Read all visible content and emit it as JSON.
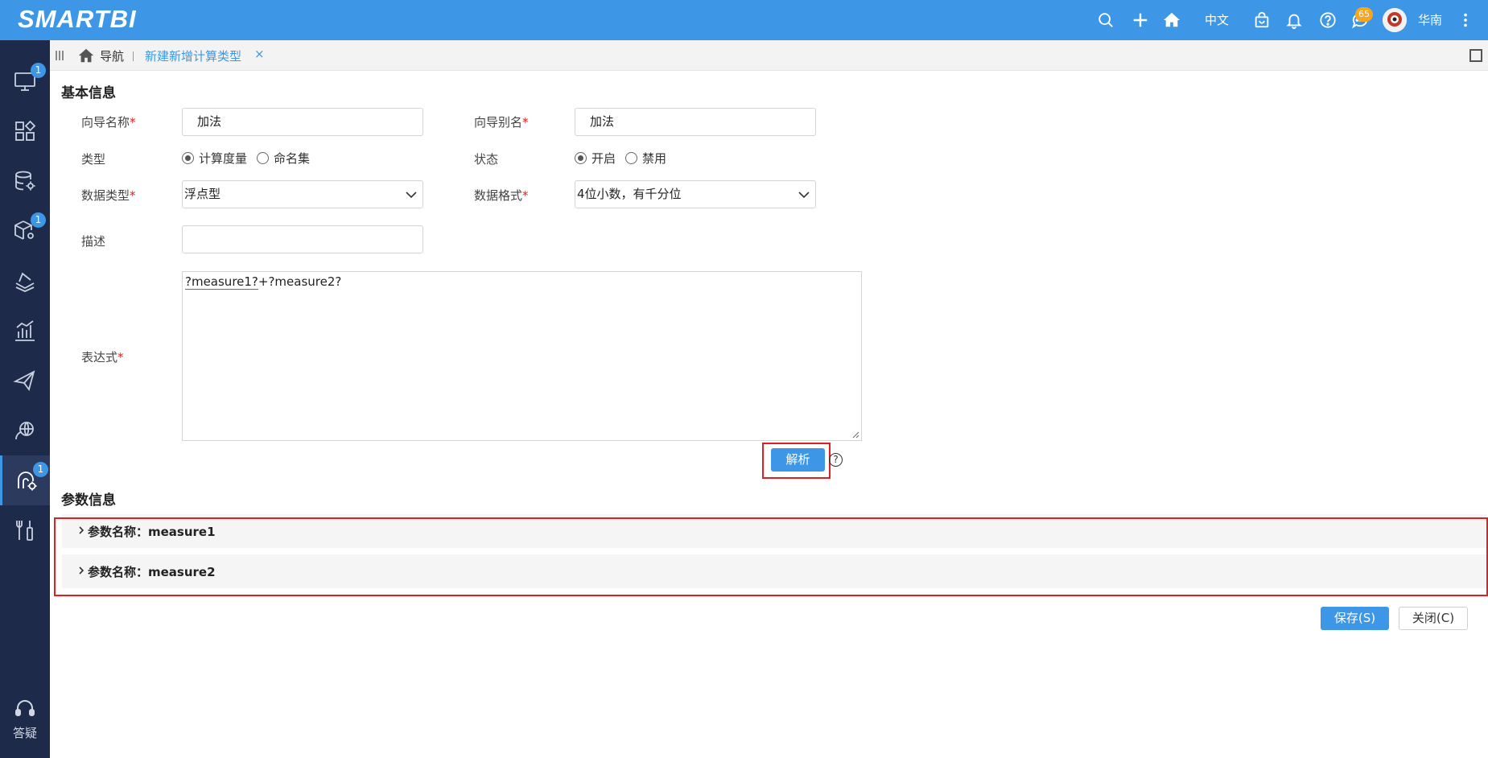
{
  "topbar": {
    "brand": "SMARTBI",
    "language": "中文",
    "messages_badge": "65",
    "user_name": "华南"
  },
  "sidebar": {
    "items": [
      {
        "icon": "monitor-icon",
        "badge": "1"
      },
      {
        "icon": "widgets-icon",
        "badge": ""
      },
      {
        "icon": "database-gear-icon",
        "badge": ""
      },
      {
        "icon": "cube-gear-icon",
        "badge": "1"
      },
      {
        "icon": "layers-icon",
        "badge": ""
      },
      {
        "icon": "bar-chart-icon",
        "badge": ""
      },
      {
        "icon": "paper-plane-icon",
        "badge": ""
      },
      {
        "icon": "headset-globe-icon",
        "badge": ""
      },
      {
        "icon": "brain-gear-icon",
        "badge": "1",
        "active": true
      },
      {
        "icon": "tools-icon",
        "badge": ""
      }
    ],
    "help_label": "答疑"
  },
  "tabstrip": {
    "nav_label": "导航",
    "active_tab": "新建新增计算类型",
    "close_glyph": "×"
  },
  "basic": {
    "title": "基本信息",
    "wizard_name_label": "向导名称",
    "wizard_name_value": "加法",
    "wizard_alias_label": "向导别名",
    "wizard_alias_value": "加法",
    "type_label": "类型",
    "type_options": [
      "计算度量",
      "命名集"
    ],
    "type_selected": "计算度量",
    "status_label": "状态",
    "status_options": [
      "开启",
      "禁用"
    ],
    "status_selected": "开启",
    "data_type_label": "数据类型",
    "data_type_value": "浮点型",
    "data_format_label": "数据格式",
    "data_format_value": "4位小数，有千分位",
    "desc_label": "描述",
    "desc_value": "",
    "expr_label": "表达式",
    "expr_part1": "?measure1?",
    "expr_part2": "+?measure2?",
    "parse_button": "解析",
    "help_glyph": "?"
  },
  "params": {
    "title": "参数信息",
    "rows": [
      {
        "label": "参数名称：measure1"
      },
      {
        "label": "参数名称：measure2"
      }
    ]
  },
  "footer": {
    "save_button": "保存(S)",
    "close_button": "关闭(C)"
  },
  "colors": {
    "accent": "#3d97e6",
    "sidebar_bg": "#1e2a4a",
    "highlight": "#e02020"
  }
}
